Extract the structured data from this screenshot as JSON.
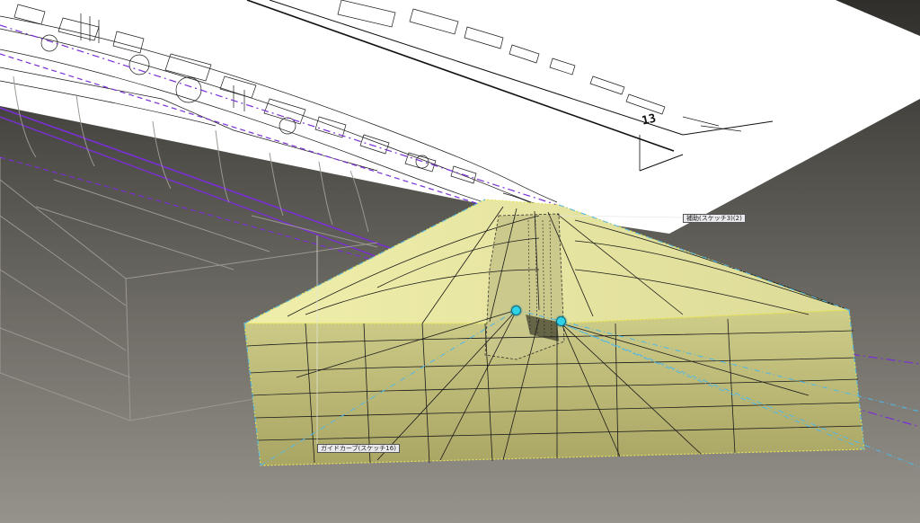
{
  "viewport": {
    "background_top": "#3b3a36",
    "background_bottom": "#8b8882",
    "paper_color": "#ffffff",
    "selected_fill": "#dedc98",
    "selection_edge_color": "#4fb8e8",
    "guide_color": "#7a2fd6",
    "wire_color": "#8a8a8a"
  },
  "drawing_sheet": {
    "sheet_number": "13"
  },
  "labels": {
    "upper_tag": "補助(スケッチ3)(2)",
    "lower_tag": "ガイドカーブ(スケッチ16)"
  },
  "handles": {
    "left_handle_icon": "control-point-icon",
    "right_handle_icon": "control-point-icon"
  }
}
